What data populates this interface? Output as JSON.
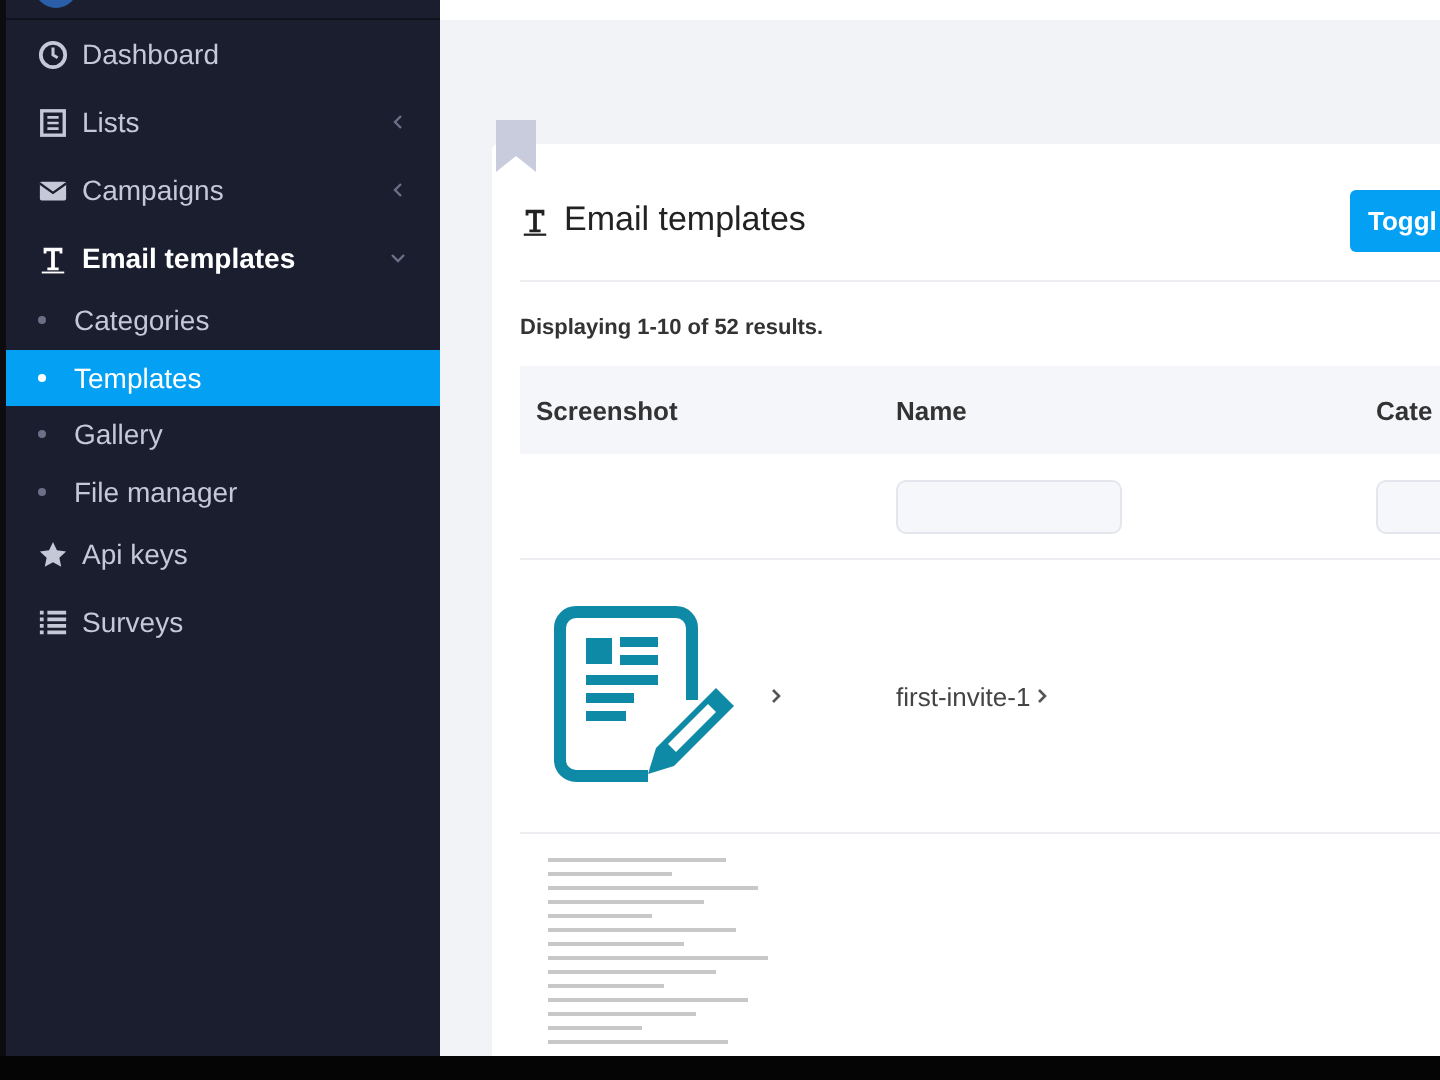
{
  "sidebar": {
    "items": [
      {
        "label": "Dashboard",
        "kind": "link",
        "selected": false
      },
      {
        "label": "Lists",
        "kind": "group",
        "selected": false,
        "expanded": false
      },
      {
        "label": "Campaigns",
        "kind": "group",
        "selected": false,
        "expanded": false
      },
      {
        "label": "Email templates",
        "kind": "group",
        "selected": true,
        "expanded": true,
        "children": [
          {
            "label": "Categories",
            "selected": false
          },
          {
            "label": "Templates",
            "selected": true
          },
          {
            "label": "Gallery",
            "selected": false
          },
          {
            "label": "File manager",
            "selected": false
          }
        ]
      },
      {
        "label": "Api keys",
        "kind": "link",
        "selected": false
      },
      {
        "label": "Surveys",
        "kind": "link",
        "selected": false
      }
    ]
  },
  "page": {
    "title": "Email templates",
    "toggle_button": "Toggl",
    "summary": "Displaying 1-10 of 52 results."
  },
  "table": {
    "columns": [
      "Screenshot",
      "Name",
      "Cate"
    ],
    "rows": [
      {
        "kind": "icon",
        "name": "first-invite-1"
      },
      {
        "kind": "document"
      }
    ]
  }
}
